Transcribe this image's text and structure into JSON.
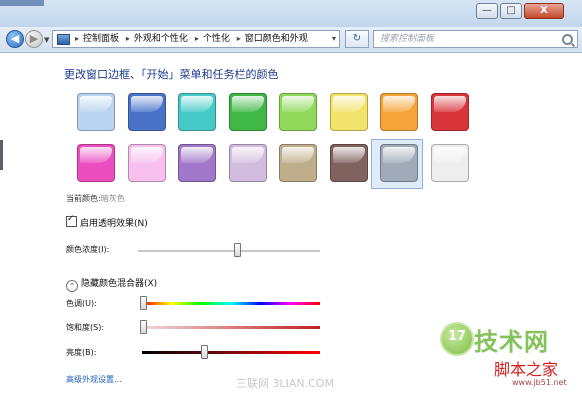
{
  "window": {
    "minimize_glyph": "—",
    "maximize_glyph": "□",
    "close_glyph": "X"
  },
  "address_bar": {
    "breadcrumbs": [
      "控制面板",
      "外观和个性化",
      "个性化",
      "窗口颜色和外观"
    ],
    "separator": "▸",
    "dropdown_glyph": "▾",
    "refresh_glyph": "↻"
  },
  "search": {
    "placeholder": "搜索控制面板"
  },
  "heading": "更改窗口边框、「开始」菜单和任务栏的颜色",
  "swatches": [
    {
      "name": "sky",
      "color": "#b9d4f0"
    },
    {
      "name": "twilight",
      "color": "#4a73c8"
    },
    {
      "name": "sea",
      "color": "#47c9c7"
    },
    {
      "name": "leaf",
      "color": "#3fb846"
    },
    {
      "name": "lime",
      "color": "#8fd85a"
    },
    {
      "name": "lemon",
      "color": "#f2e46a"
    },
    {
      "name": "tangerine",
      "color": "#f6a437"
    },
    {
      "name": "ruby",
      "color": "#d8353b"
    },
    {
      "name": "fuchsia",
      "color": "#ec4ec0"
    },
    {
      "name": "blush",
      "color": "#f7c0ef"
    },
    {
      "name": "violet",
      "color": "#a177c9"
    },
    {
      "name": "lavender",
      "color": "#d2bde0"
    },
    {
      "name": "taupe",
      "color": "#bfae8c"
    },
    {
      "name": "chocolate",
      "color": "#80625e"
    },
    {
      "name": "slate",
      "color": "#a0aab8"
    },
    {
      "name": "frost",
      "color": "#eeeeee"
    }
  ],
  "selected_swatch": "slate",
  "current_color": {
    "label": "当前颜色:",
    "value": "暗灰色"
  },
  "transparency": {
    "label": "启用透明效果(N)",
    "checked": true,
    "check_glyph": "✓"
  },
  "intensity": {
    "label": "颜色浓度(I):",
    "level": 0.55
  },
  "mixer_toggle": {
    "label": "隐藏颜色混合器(X)",
    "glyph": "⌃"
  },
  "hue": {
    "label": "色调(U):",
    "level": 0.0
  },
  "saturation": {
    "label": "饱和度(S):",
    "level": 0.0
  },
  "brightness": {
    "label": "亮度(B):",
    "level": 0.35
  },
  "advanced_link": "高级外观设置...",
  "watermarks": {
    "center": "三联网 3LIAN.COM",
    "logo": "17",
    "tech": "技术网",
    "sub": "脚本之家",
    "url": "www.jb51.net"
  },
  "colors": {
    "heading": "#1e3a8a",
    "link": "#1b5bbd",
    "selection": "#dfecfb"
  }
}
